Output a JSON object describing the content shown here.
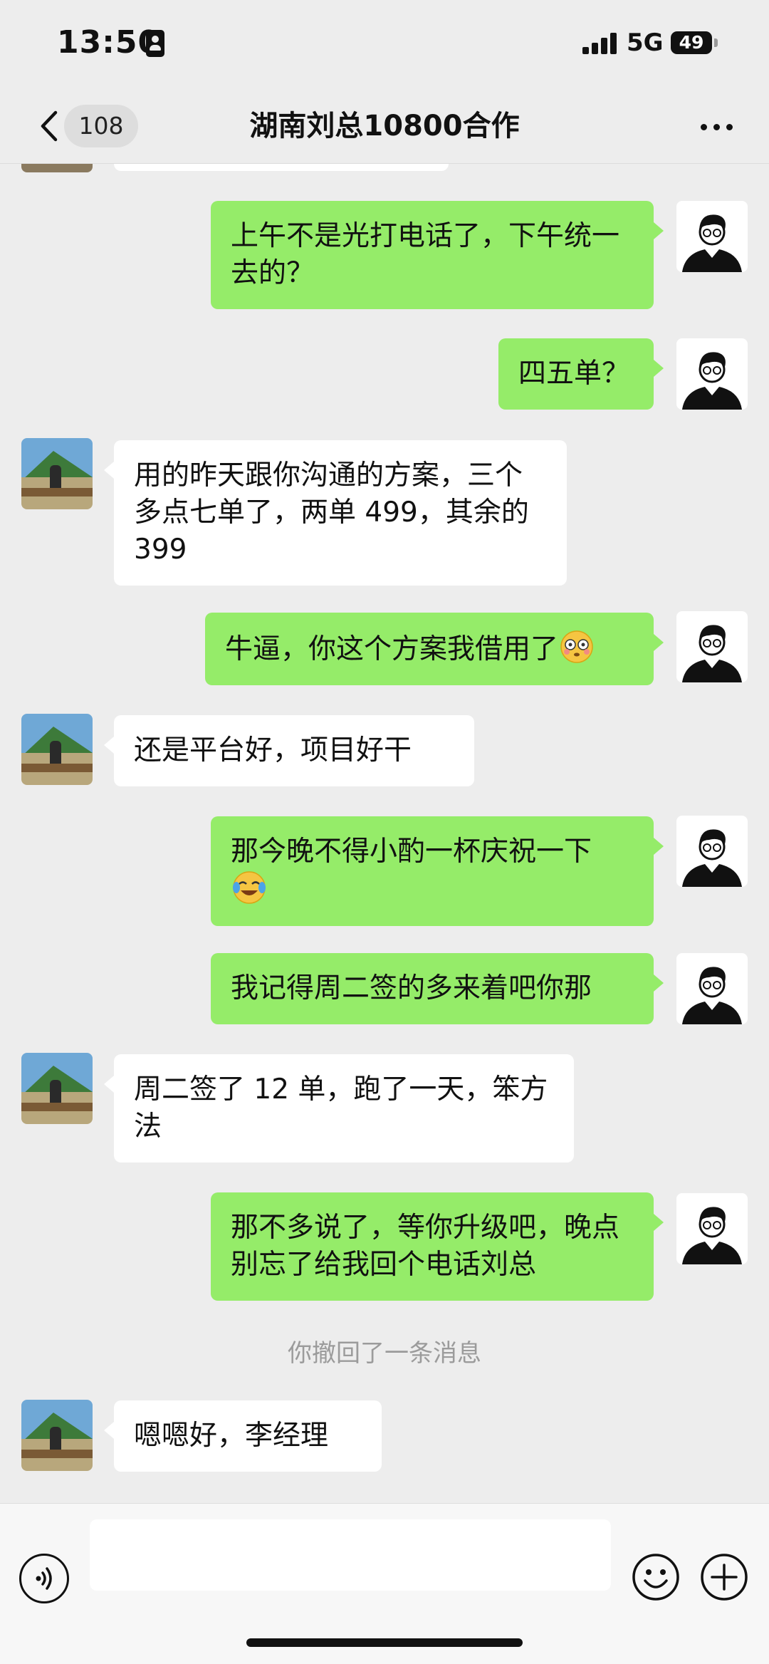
{
  "status_bar": {
    "time": "13:50",
    "network": "5G",
    "battery": "49"
  },
  "nav": {
    "unread_count": "108",
    "title": "湖南刘总10800合作"
  },
  "messages": [
    {
      "from": "me",
      "text": "上午不是光打电话了，下午统一去的？"
    },
    {
      "from": "me",
      "text": "四五单？"
    },
    {
      "from": "them",
      "text": "用的昨天跟你沟通的方案，三个多点七单了，两单 499，其余的 399"
    },
    {
      "from": "me",
      "text": "牛逼，你这个方案我借用了",
      "emoji": "flushed-face"
    },
    {
      "from": "them",
      "text": "还是平台好，项目好干"
    },
    {
      "from": "me",
      "text": "那今晚不得小酌一杯庆祝一下",
      "emoji": "tears-of-joy-face"
    },
    {
      "from": "me",
      "text": "我记得周二签的多来着吧你那"
    },
    {
      "from": "them",
      "text": "周二签了 12 单，跑了一天，笨方法"
    },
    {
      "from": "me",
      "text": "那不多说了，等你升级吧，晚点别忘了给我回个电话刘总"
    },
    {
      "from": "system",
      "text": "你撤回了一条消息"
    },
    {
      "from": "them",
      "text": "嗯嗯好，李经理"
    }
  ],
  "colors": {
    "me_bubble": "#95ec69",
    "them_bubble": "#ffffff",
    "background": "#ededed"
  }
}
